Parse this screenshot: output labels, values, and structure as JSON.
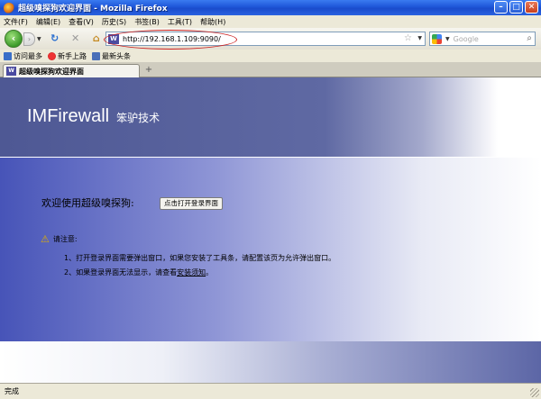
{
  "window": {
    "title": "超级嗅探狗欢迎界面 - Mozilla Firefox"
  },
  "menu": [
    "文件(F)",
    "编辑(E)",
    "查看(V)",
    "历史(S)",
    "书签(B)",
    "工具(T)",
    "帮助(H)"
  ],
  "nav": {
    "url": "http://192.168.1.109:9090/",
    "search_placeholder": "Google"
  },
  "bookmarks": [
    "访问最多",
    "新手上路",
    "最新头条"
  ],
  "tabs": [
    {
      "label": "超级嗅探狗欢迎界面"
    }
  ],
  "page": {
    "product": "IMFirewall",
    "company": "笨驴技术",
    "welcome": "欢迎使用超级嗅探狗:",
    "open_button": "点击打开登录界面",
    "notice_label": "请注意:",
    "notes": [
      "1、打开登录界面需要弹出窗口，如果您安装了工具条，请配置该页为允许弹出窗口。",
      "2、如果登录界面无法显示，请查看"
    ],
    "install_link": "安装须知",
    "note2_end": "。"
  },
  "status": {
    "text": "完成"
  }
}
